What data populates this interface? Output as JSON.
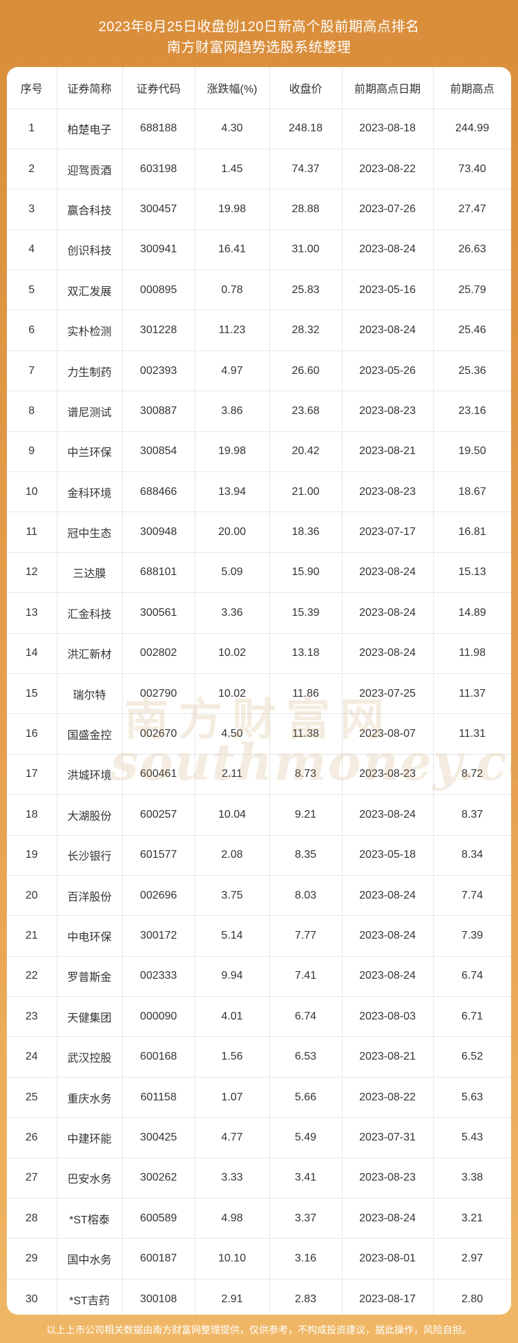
{
  "header": {
    "title_line1": "2023年8月25日收盘创120日新高个股前期高点排名",
    "title_line2": "南方财富网趋势选股系统整理"
  },
  "table": {
    "columns": [
      "序号",
      "证券简称",
      "证券代码",
      "涨跌幅(%)",
      "收盘价",
      "前期高点日期",
      "前期高点"
    ],
    "rows": [
      [
        "1",
        "柏楚电子",
        "688188",
        "4.30",
        "248.18",
        "2023-08-18",
        "244.99"
      ],
      [
        "2",
        "迎驾贡酒",
        "603198",
        "1.45",
        "74.37",
        "2023-08-22",
        "73.40"
      ],
      [
        "3",
        "赢合科技",
        "300457",
        "19.98",
        "28.88",
        "2023-07-26",
        "27.47"
      ],
      [
        "4",
        "创识科技",
        "300941",
        "16.41",
        "31.00",
        "2023-08-24",
        "26.63"
      ],
      [
        "5",
        "双汇发展",
        "000895",
        "0.78",
        "25.83",
        "2023-05-16",
        "25.79"
      ],
      [
        "6",
        "实朴检测",
        "301228",
        "11.23",
        "28.32",
        "2023-08-24",
        "25.46"
      ],
      [
        "7",
        "力生制药",
        "002393",
        "4.97",
        "26.60",
        "2023-05-26",
        "25.36"
      ],
      [
        "8",
        "谱尼测试",
        "300887",
        "3.86",
        "23.68",
        "2023-08-23",
        "23.16"
      ],
      [
        "9",
        "中兰环保",
        "300854",
        "19.98",
        "20.42",
        "2023-08-21",
        "19.50"
      ],
      [
        "10",
        "金科环境",
        "688466",
        "13.94",
        "21.00",
        "2023-08-23",
        "18.67"
      ],
      [
        "11",
        "冠中生态",
        "300948",
        "20.00",
        "18.36",
        "2023-07-17",
        "16.81"
      ],
      [
        "12",
        "三达膜",
        "688101",
        "5.09",
        "15.90",
        "2023-08-24",
        "15.13"
      ],
      [
        "13",
        "汇金科技",
        "300561",
        "3.36",
        "15.39",
        "2023-08-24",
        "14.89"
      ],
      [
        "14",
        "洪汇新材",
        "002802",
        "10.02",
        "13.18",
        "2023-08-24",
        "11.98"
      ],
      [
        "15",
        "瑞尔特",
        "002790",
        "10.02",
        "11.86",
        "2023-07-25",
        "11.37"
      ],
      [
        "16",
        "国盛金控",
        "002670",
        "4.50",
        "11.38",
        "2023-08-07",
        "11.31"
      ],
      [
        "17",
        "洪城环境",
        "600461",
        "2.11",
        "8.73",
        "2023-08-23",
        "8.72"
      ],
      [
        "18",
        "大湖股份",
        "600257",
        "10.04",
        "9.21",
        "2023-08-24",
        "8.37"
      ],
      [
        "19",
        "长沙银行",
        "601577",
        "2.08",
        "8.35",
        "2023-05-18",
        "8.34"
      ],
      [
        "20",
        "百洋股份",
        "002696",
        "3.75",
        "8.03",
        "2023-08-24",
        "7.74"
      ],
      [
        "21",
        "中电环保",
        "300172",
        "5.14",
        "7.77",
        "2023-08-24",
        "7.39"
      ],
      [
        "22",
        "罗普斯金",
        "002333",
        "9.94",
        "7.41",
        "2023-08-24",
        "6.74"
      ],
      [
        "23",
        "天健集团",
        "000090",
        "4.01",
        "6.74",
        "2023-08-03",
        "6.71"
      ],
      [
        "24",
        "武汉控股",
        "600168",
        "1.56",
        "6.53",
        "2023-08-21",
        "6.52"
      ],
      [
        "25",
        "重庆水务",
        "601158",
        "1.07",
        "5.66",
        "2023-08-22",
        "5.63"
      ],
      [
        "26",
        "中建环能",
        "300425",
        "4.77",
        "5.49",
        "2023-07-31",
        "5.43"
      ],
      [
        "27",
        "巴安水务",
        "300262",
        "3.33",
        "3.41",
        "2023-08-23",
        "3.38"
      ],
      [
        "28",
        "*ST榕泰",
        "600589",
        "4.98",
        "3.37",
        "2023-08-24",
        "3.21"
      ],
      [
        "29",
        "国中水务",
        "600187",
        "10.10",
        "3.16",
        "2023-08-01",
        "2.97"
      ],
      [
        "30",
        "*ST吉药",
        "300108",
        "2.91",
        "2.83",
        "2023-08-17",
        "2.80"
      ]
    ]
  },
  "watermark": {
    "text_cn": "南方财富网",
    "text_en": "southmoney.com"
  },
  "footer": {
    "disclaimer": "以上上市公司相关数据由南方财富网整理提供，仅供参考，不构成投资建议，据此操作，风险自担。"
  },
  "colors": {
    "background_top": "#d98d3a",
    "background_bottom": "#efb766",
    "card": "#ffffff",
    "grid": "#e6e6e6",
    "text": "#333333"
  }
}
